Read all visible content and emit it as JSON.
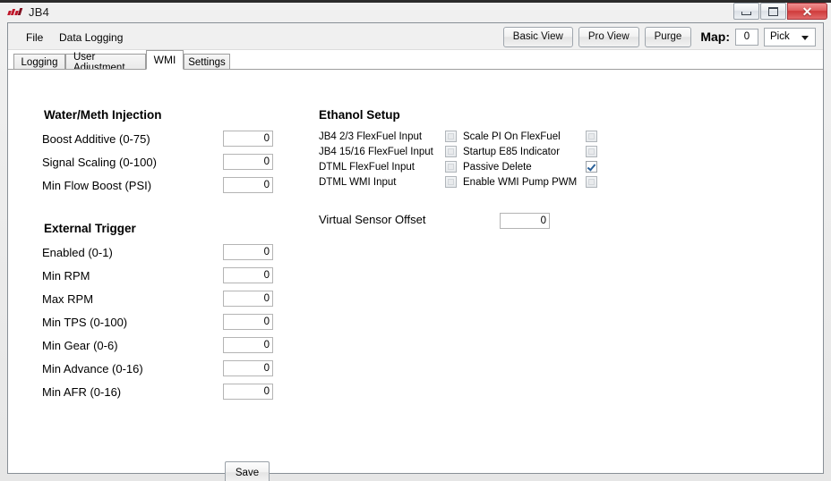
{
  "window": {
    "title": "JB4",
    "icon": "jb4-logo-icon",
    "controls": {
      "minimize": "minimize-button",
      "maximize": "maximize-button",
      "close_glyph": "✕"
    }
  },
  "menu": {
    "items": [
      {
        "label": "File"
      },
      {
        "label": "Data Logging"
      }
    ]
  },
  "toolbar": {
    "buttons": [
      {
        "label": "Basic View"
      },
      {
        "label": "Pro View"
      },
      {
        "label": "Purge"
      }
    ],
    "map_label": "Map:",
    "map_value": "0",
    "pick_selected": "Pick",
    "pick_options": [
      "Pick"
    ]
  },
  "tabs": [
    {
      "label": "Logging",
      "active": false
    },
    {
      "label": "User Adjustment",
      "active": false
    },
    {
      "label": "WMI",
      "active": true
    },
    {
      "label": "Settings",
      "active": false
    }
  ],
  "wmi": {
    "section_title": "Water/Meth Injection",
    "fields": [
      {
        "label": "Boost Additive (0-75)",
        "value": "0"
      },
      {
        "label": "Signal Scaling (0-100)",
        "value": "0"
      },
      {
        "label": "Min Flow Boost (PSI)",
        "value": "0"
      }
    ]
  },
  "external_trigger": {
    "section_title": "External Trigger",
    "fields": [
      {
        "label": "Enabled (0-1)",
        "value": "0"
      },
      {
        "label": "Min RPM",
        "value": "0"
      },
      {
        "label": "Max RPM",
        "value": "0"
      },
      {
        "label": "Min TPS (0-100)",
        "value": "0"
      },
      {
        "label": "Min Gear (0-6)",
        "value": "0"
      },
      {
        "label": "Min Advance (0-16)",
        "value": "0"
      },
      {
        "label": "Min AFR (0-16)",
        "value": "0"
      }
    ]
  },
  "ethanol": {
    "section_title": "Ethanol Setup",
    "left_checkboxes": [
      {
        "label": "JB4 2/3 FlexFuel Input",
        "checked": false
      },
      {
        "label": "JB4 15/16 FlexFuel Input",
        "checked": false
      },
      {
        "label": "DTML FlexFuel Input",
        "checked": false
      },
      {
        "label": "DTML WMI Input",
        "checked": false
      }
    ],
    "right_checkboxes": [
      {
        "label": "Scale PI On FlexFuel",
        "checked": false
      },
      {
        "label": "Startup E85 Indicator",
        "checked": false
      },
      {
        "label": "Passive Delete",
        "checked": true
      },
      {
        "label": "Enable WMI Pump PWM",
        "checked": false
      }
    ],
    "virtual_sensor_offset": {
      "label": "Virtual Sensor Offset",
      "value": "0"
    }
  },
  "actions": {
    "save_label": "Save"
  },
  "colors": {
    "accent_red": "#c0182b",
    "check_blue": "#2a6099",
    "window_chrome": "#f0f0f0",
    "client_bg": "#ffffff"
  }
}
